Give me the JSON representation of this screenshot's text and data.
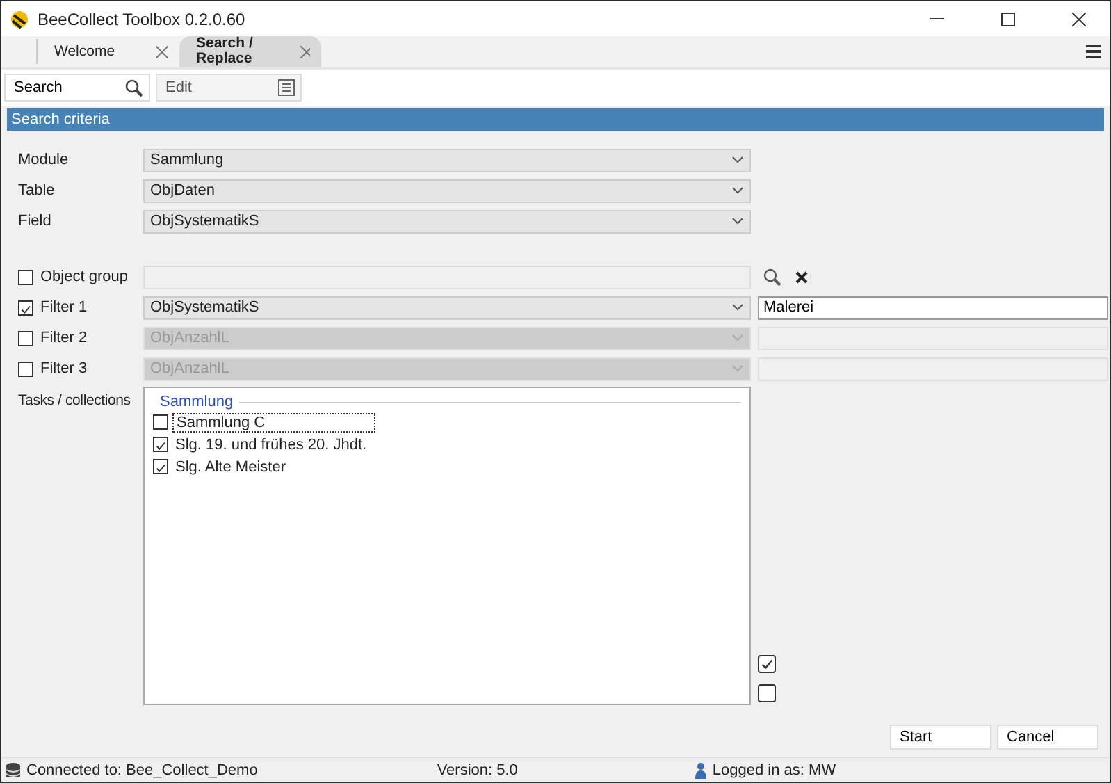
{
  "window": {
    "title": "BeeCollect Toolbox 0.2.0.60"
  },
  "tabs": [
    {
      "label": "Welcome",
      "selected": false
    },
    {
      "label": "Search / Replace",
      "selected": true
    }
  ],
  "toolbar": {
    "search": "Search",
    "edit": "Edit"
  },
  "section_header": "Search criteria",
  "selectors": [
    {
      "label": "Module",
      "value": "Sammlung"
    },
    {
      "label": "Table",
      "value": "ObjDaten"
    },
    {
      "label": "Field",
      "value": "ObjSystematikS"
    }
  ],
  "filters": [
    {
      "kind": "group",
      "label": "Object group",
      "checked": false
    },
    {
      "kind": "filter",
      "label": "Filter 1",
      "checked": true,
      "disabled": false,
      "field": "ObjSystematikS",
      "value": "Malerei"
    },
    {
      "kind": "filter",
      "label": "Filter 2",
      "checked": false,
      "disabled": true,
      "field": "ObjAnzahlL"
    },
    {
      "kind": "filter",
      "label": "Filter 3",
      "checked": false,
      "disabled": true,
      "field": "ObjAnzahlL"
    }
  ],
  "tasks": {
    "label": "Tasks / collections",
    "group": "Sammlung",
    "items": [
      {
        "label": "Sammlung C",
        "checked": false,
        "focused": true
      },
      {
        "label": "Slg. 19. und frühes 20. Jhdt.",
        "checked": true,
        "focused": false
      },
      {
        "label": "Slg. Alte Meister",
        "checked": true,
        "focused": false
      }
    ]
  },
  "bulk_checkboxes": [
    {
      "checked": true
    },
    {
      "checked": false
    }
  ],
  "buttons": [
    "Start",
    "Cancel"
  ],
  "status_bar": {
    "connection": "Connected to: Bee_Collect_Demo",
    "version": "Version: 5.0",
    "user": "Logged in as: MW"
  }
}
